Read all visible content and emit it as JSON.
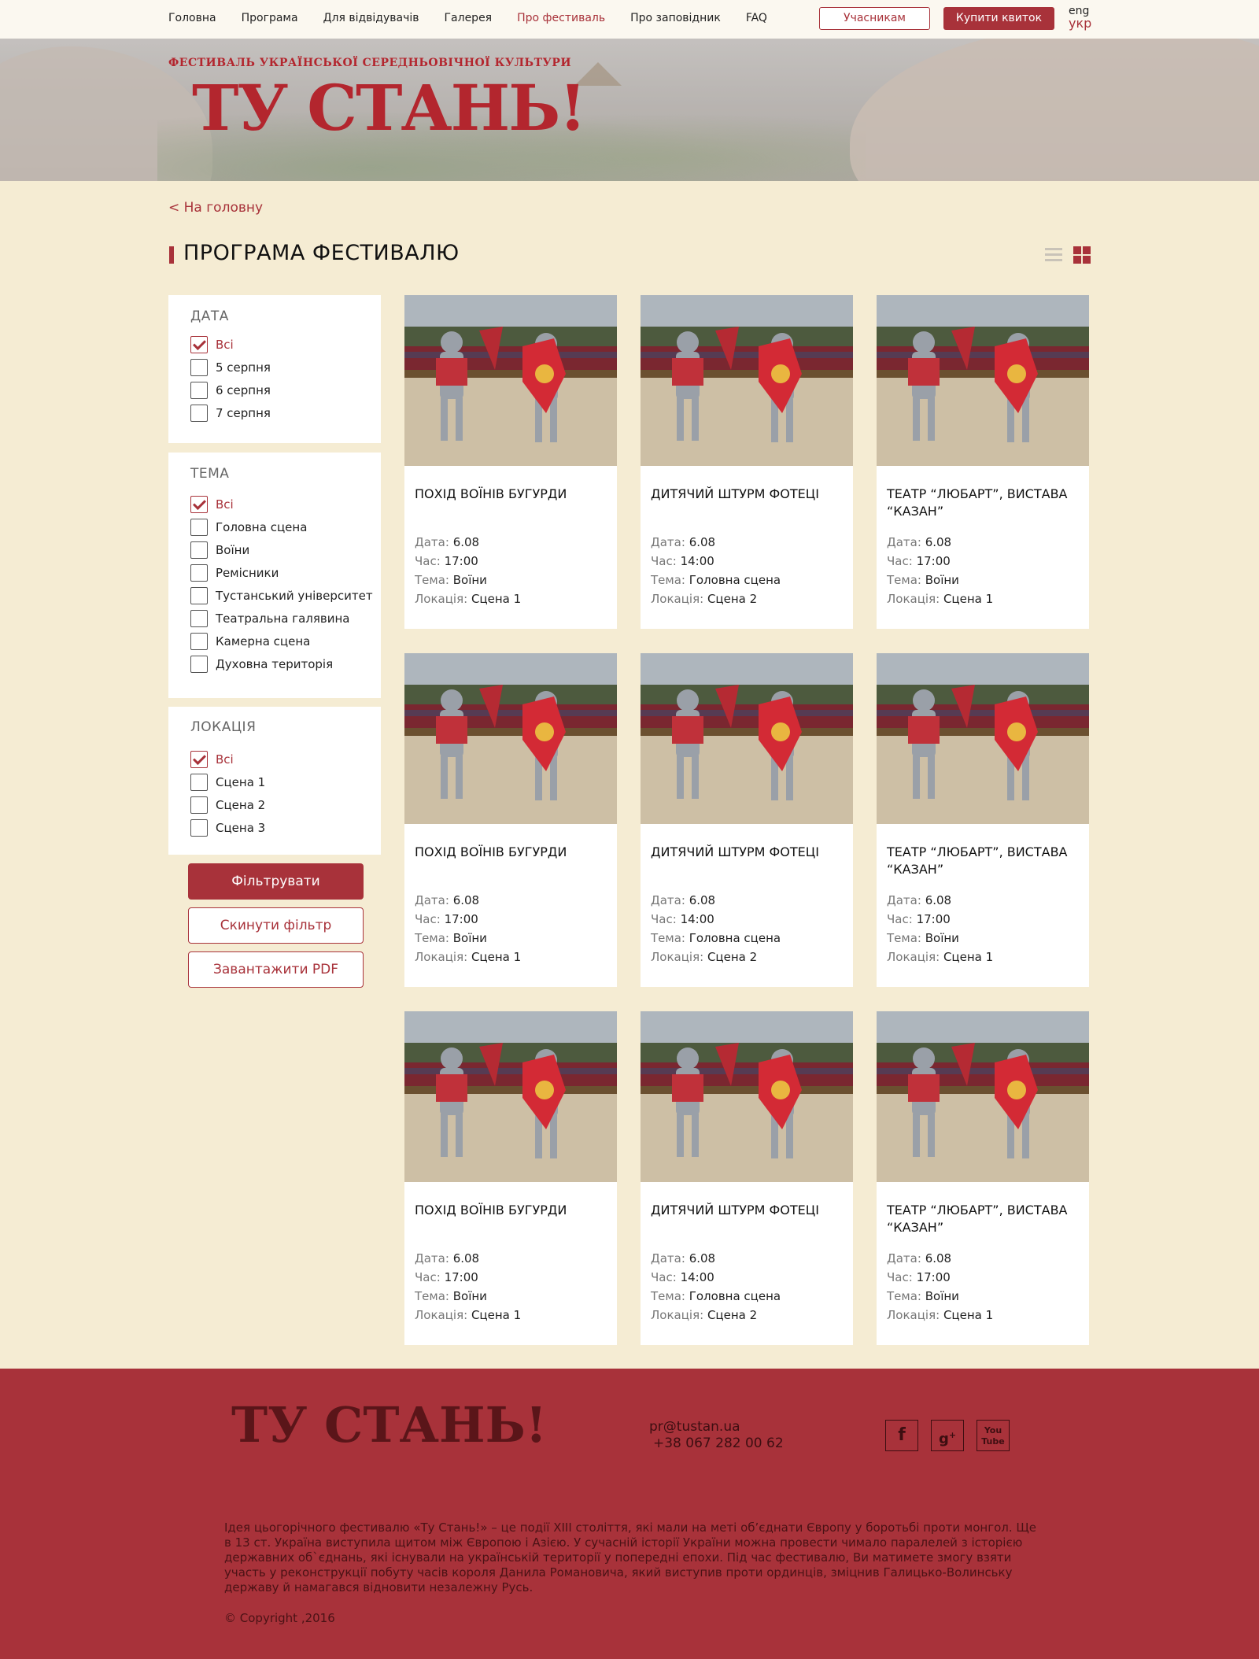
{
  "nav": {
    "links": [
      "Головна",
      "Програма",
      "Для відвідувачів",
      "Галерея",
      "Про фестиваль",
      "Про заповідник",
      "FAQ"
    ],
    "active_index": 4,
    "participants_label": "Учасникам",
    "buy_label": "Купити квиток",
    "lang_en": "eng",
    "lang_uk": "укр"
  },
  "banner": {
    "subtitle": "ФЕСТИВАЛЬ УКРАЇНСЬКОЇ СЕРЕДНЬОВІЧНОЇ КУЛЬТУРИ",
    "logo": "ТУ СТАНЬ!"
  },
  "page": {
    "back_link": "< На головну",
    "title": "ПРОГРАМА ФЕСТИВАЛЮ"
  },
  "filters": {
    "date": {
      "title": "ДАТА",
      "options": [
        "Всі",
        "5 серпня",
        "6 серпня",
        "7 серпня"
      ]
    },
    "theme": {
      "title": "ТЕМА",
      "options": [
        "Всі",
        "Головна сцена",
        "Воїни",
        "Ремісники",
        "Тустанський університет",
        "Театральна галявина",
        "Камерна сцена",
        "Духовна територія"
      ]
    },
    "location": {
      "title": "ЛОКАЦІЯ",
      "options": [
        "Всі",
        "Сцена 1",
        "Сцена 2",
        "Сцена 3"
      ]
    },
    "apply_label": "Фільтрувати",
    "reset_label": "Скинути фільтр",
    "pdf_label": "Завантажити PDF"
  },
  "labels": {
    "date": "Дата:",
    "time": "Час:",
    "theme": "Тема:",
    "location": "Локація:"
  },
  "events": [
    {
      "title": "ПОХІД ВОЇНІВ БУГУРДИ",
      "date": "6.08",
      "time": "17:00",
      "theme": "Воїни",
      "location": "Сцена 1"
    },
    {
      "title": "ДИТЯЧИЙ ШТУРМ ФОТЕЦІ",
      "date": "6.08",
      "time": "14:00",
      "theme": "Головна сцена",
      "location": "Сцена 2"
    },
    {
      "title": "ТЕАТР “ЛЮБАРТ”, ВИСТАВА “КАЗАН”",
      "date": "6.08",
      "time": "17:00",
      "theme": "Воїни",
      "location": "Сцена 1"
    },
    {
      "title": "ПОХІД ВОЇНІВ БУГУРДИ",
      "date": "6.08",
      "time": "17:00",
      "theme": "Воїни",
      "location": "Сцена 1"
    },
    {
      "title": "ДИТЯЧИЙ ШТУРМ ФОТЕЦІ",
      "date": "6.08",
      "time": "14:00",
      "theme": "Головна сцена",
      "location": "Сцена 2"
    },
    {
      "title": "ТЕАТР “ЛЮБАРТ”, ВИСТАВА “КАЗАН”",
      "date": "6.08",
      "time": "17:00",
      "theme": "Воїни",
      "location": "Сцена 1"
    },
    {
      "title": "ПОХІД ВОЇНІВ БУГУРДИ",
      "date": "6.08",
      "time": "17:00",
      "theme": "Воїни",
      "location": "Сцена 1"
    },
    {
      "title": "ДИТЯЧИЙ ШТУРМ ФОТЕЦІ",
      "date": "6.08",
      "time": "14:00",
      "theme": "Головна сцена",
      "location": "Сцена 2"
    },
    {
      "title": "ТЕАТР “ЛЮБАРТ”, ВИСТАВА “КАЗАН”",
      "date": "6.08",
      "time": "17:00",
      "theme": "Воїни",
      "location": "Сцена 1"
    }
  ],
  "footer": {
    "logo": "ТУ СТАНЬ!",
    "email": "pr@tustan.ua",
    "phone": "+38 067 282 00 62",
    "social": [
      "facebook-icon",
      "google-plus-icon",
      "youtube-icon"
    ],
    "about": "Ідея цьогорічного фестивалю «Ту Стань!» – це події XIII століття, які мали на меті об’єднати Європу у боротьбі проти монгол. Ще в 13 ст. Україна виступила щитом між Європою і Азією. У сучасній історії України можна провести чимало паралелей з історією державних об`єднань, які існували на українській території у попередні епохи. Під час фестивалю, Ви матимете змогу взяти участь у реконструкції побуту часів короля Данила Романовича, який виступив проти ординців, зміцнив Галицько-Волинську державу й намагався відновити незалежну Русь.",
    "copyright": "© Copyright ,2016"
  },
  "colors": {
    "accent": "#a8323a",
    "background": "#f5ecd3",
    "footer": "#a8323a"
  }
}
